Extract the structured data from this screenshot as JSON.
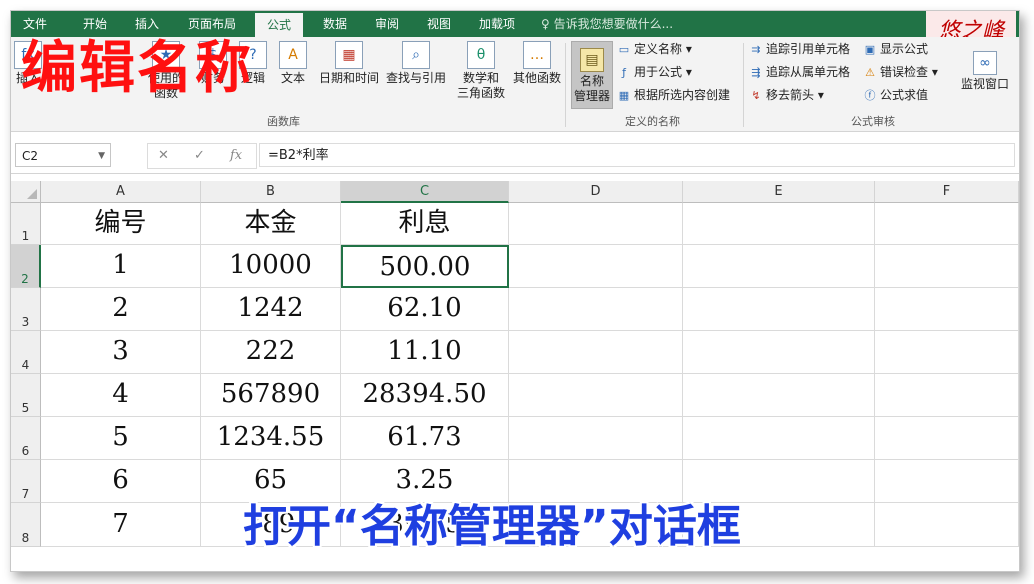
{
  "ribbon_tabs": [
    "文件",
    "开始",
    "插入",
    "页面布局",
    "公式",
    "数据",
    "审阅",
    "视图",
    "加载项"
  ],
  "active_tab": "公式",
  "tell_me": "告诉我您想要做什么...",
  "signature": "悠之峰",
  "function_library": {
    "buttons": [
      "日期和时间",
      "查找与引用",
      "数学和\n三角函数",
      "其他函数"
    ],
    "partial_labels": [
      "插入",
      "使用的",
      "财务",
      "逻辑",
      "文本",
      "函数"
    ],
    "group_label": "函数库"
  },
  "defined_names": {
    "name_manager": "名称\n管理器",
    "items": [
      "定义名称",
      "用于公式",
      "根据所选内容创建"
    ],
    "group_label": "定义的名称"
  },
  "formula_auditing": {
    "items_left": [
      "追踪引用单元格",
      "追踪从属单元格",
      "移去箭头"
    ],
    "items_right": [
      "显示公式",
      "错误检查",
      "公式求值"
    ],
    "watch_window": "监视窗口",
    "group_label": "公式审核"
  },
  "overlay_title": "编辑名称",
  "overlay_subtitle": "打开“名称管理器”对话框",
  "formula_bar": {
    "name_box": "C2",
    "formula": "=B2*利率"
  },
  "columns": [
    "A",
    "B",
    "C",
    "D",
    "E",
    "F"
  ],
  "rows": [
    "1",
    "2",
    "3",
    "4",
    "5",
    "6",
    "7",
    "8"
  ],
  "cells": [
    [
      "编号",
      "本金",
      "利息"
    ],
    [
      "1",
      "10000",
      "500.00"
    ],
    [
      "2",
      "1242",
      "62.10"
    ],
    [
      "3",
      "222",
      "11.10"
    ],
    [
      "4",
      "567890",
      "28394.50"
    ],
    [
      "5",
      "1234.55",
      "61.73"
    ],
    [
      "6",
      "65",
      "3.25"
    ],
    [
      "7",
      "789",
      "39.45"
    ]
  ],
  "colors": {
    "accent": "#217346",
    "title": "#ff1010",
    "subtitle": "#1f3fe0"
  }
}
